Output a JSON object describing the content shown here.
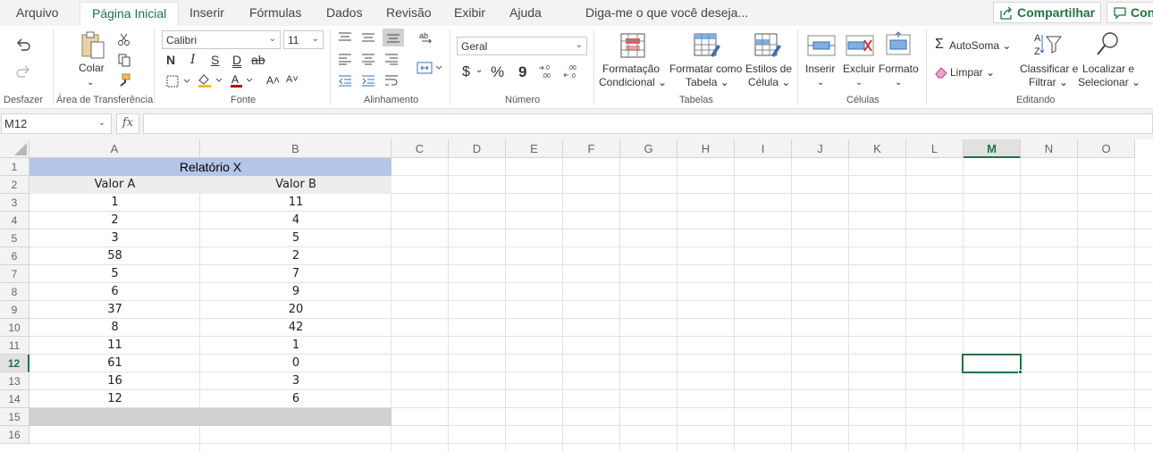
{
  "tabs": [
    {
      "label": "Arquivo"
    },
    {
      "label": "Página Inicial"
    },
    {
      "label": "Inserir"
    },
    {
      "label": "Fórmulas"
    },
    {
      "label": "Dados"
    },
    {
      "label": "Revisão"
    },
    {
      "label": "Exibir"
    },
    {
      "label": "Ajuda"
    }
  ],
  "tell_me": "Diga-me o que você deseja...",
  "share_label": "Compartilhar",
  "comments_label": "Con",
  "ribbon": {
    "undo": {
      "group": "Desfazer"
    },
    "clipboard": {
      "paste": "Colar",
      "group": "Área de Transferência"
    },
    "font": {
      "name": "Calibri",
      "size": "11",
      "bold": "N",
      "italic": "I",
      "underline": "S",
      "double_underline": "D",
      "strike": "ab",
      "group": "Fonte"
    },
    "alignment": {
      "group": "Alinhamento"
    },
    "number": {
      "format": "Geral",
      "currency": "$",
      "percent": "%",
      "comma": "9",
      "group": "Número"
    },
    "tables": {
      "cond_format_1": "Formatação",
      "cond_format_2": "Condicional",
      "format_table_1": "Formatar como",
      "format_table_2": "Tabela",
      "cell_styles_1": "Estilos de",
      "cell_styles_2": "Célula",
      "group": "Tabelas"
    },
    "cells": {
      "insert": "Inserir",
      "delete": "Excluir",
      "format": "Formato",
      "group": "Células"
    },
    "editing": {
      "autosum": "AutoSoma",
      "clear": "Limpar",
      "sort_1": "Classificar e",
      "sort_2": "Filtrar",
      "find_1": "Localizar e",
      "find_2": "Selecionar",
      "group": "Editando"
    }
  },
  "formula_bar": {
    "name_box": "M12",
    "fx": "fx",
    "value": ""
  },
  "columns": [
    "A",
    "B",
    "C",
    "D",
    "E",
    "F",
    "G",
    "H",
    "I",
    "J",
    "K",
    "L",
    "M",
    "N",
    "O"
  ],
  "selected_column": "M",
  "selected_row": "12",
  "rows": [
    "1",
    "2",
    "3",
    "4",
    "5",
    "6",
    "7",
    "8",
    "9",
    "10",
    "11",
    "12",
    "13",
    "14",
    "15",
    "16"
  ],
  "sheet": {
    "title": "Relatório X",
    "header_a": "Valor A",
    "header_b": "Valor B",
    "data": [
      [
        "1",
        "11"
      ],
      [
        "2",
        "4"
      ],
      [
        "3",
        "5"
      ],
      [
        "58",
        "2"
      ],
      [
        "5",
        "7"
      ],
      [
        "6",
        "9"
      ],
      [
        "37",
        "20"
      ],
      [
        "8",
        "42"
      ],
      [
        "11",
        "1"
      ],
      [
        "61",
        "0"
      ],
      [
        "16",
        "3"
      ],
      [
        "12",
        "6"
      ]
    ]
  }
}
